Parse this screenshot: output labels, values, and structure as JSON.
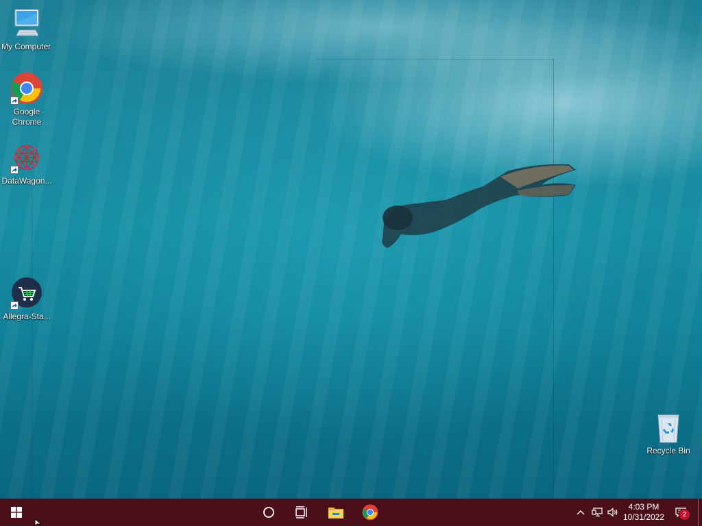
{
  "desktop": {
    "icons": [
      {
        "label": "My Computer",
        "icon": "computer-icon"
      },
      {
        "label": "Google Chrome",
        "icon": "chrome-icon"
      },
      {
        "label": "DataWagon...",
        "icon": "datawagon-icon"
      },
      {
        "label": "Allegra-Sta...",
        "icon": "shopping-cart-icon"
      },
      {
        "label": "Recycle Bin",
        "icon": "recycle-bin-icon"
      }
    ],
    "wallpaper": "underwater-swimmer"
  },
  "taskbar": {
    "background": "#4b0f1a",
    "start_icon": "windows-start-icon",
    "search_icon": "cortana-circle-icon",
    "taskview_icon": "task-view-icon",
    "pinned": [
      {
        "name": "File Explorer",
        "icon": "folder-icon"
      },
      {
        "name": "Google Chrome",
        "icon": "chrome-icon"
      }
    ],
    "tray": {
      "time": "4:03 PM",
      "date": "10/31/2022",
      "notification_count": "2"
    }
  }
}
